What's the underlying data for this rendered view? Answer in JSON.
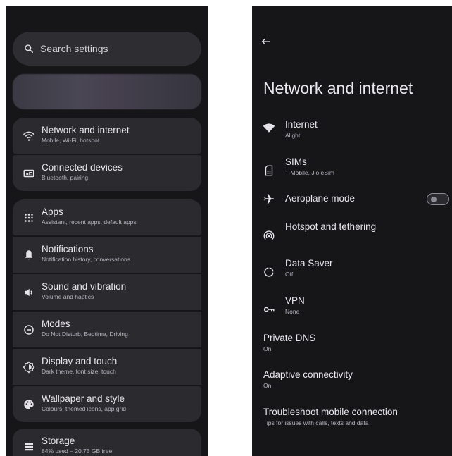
{
  "settings": {
    "search": {
      "placeholder": "Search settings"
    },
    "groups": [
      [
        {
          "title": "Network and internet",
          "subtitle": "Mobile, Wi-Fi, hotspot",
          "icon": "wifi-icon"
        },
        {
          "title": "Connected devices",
          "subtitle": "Bluetooth, pairing",
          "icon": "connected-devices-icon"
        }
      ],
      [
        {
          "title": "Apps",
          "subtitle": "Assistant, recent apps, default apps",
          "icon": "apps-grid-icon"
        },
        {
          "title": "Notifications",
          "subtitle": "Notification history, conversations",
          "icon": "bell-icon"
        },
        {
          "title": "Sound and vibration",
          "subtitle": "Volume and haptics",
          "icon": "speaker-icon"
        },
        {
          "title": "Modes",
          "subtitle": "Do Not Disturb, Bedtime, Driving",
          "icon": "modes-icon"
        },
        {
          "title": "Display and touch",
          "subtitle": "Dark theme, font size, touch",
          "icon": "display-icon"
        },
        {
          "title": "Wallpaper and style",
          "subtitle": "Colours, themed icons, app grid",
          "icon": "palette-icon"
        }
      ],
      [
        {
          "title": "Storage",
          "subtitle": "84% used – 20.75 GB free",
          "icon": "storage-icon"
        }
      ]
    ]
  },
  "network": {
    "title": "Network and internet",
    "items": [
      {
        "title": "Internet",
        "subtitle": "Alight",
        "icon": "wifi-filled-icon"
      },
      {
        "title": "SIMs",
        "subtitle": "T-Mobile, Jio eSim",
        "icon": "sim-card-icon"
      },
      {
        "title": "Aeroplane mode",
        "subtitle": "",
        "icon": "airplane-icon",
        "toggle": false
      },
      {
        "title": "Hotspot and tethering",
        "subtitle": "",
        "icon": "hotspot-icon"
      },
      {
        "title": "Data Saver",
        "subtitle": "Off",
        "icon": "data-saver-icon"
      },
      {
        "title": "VPN",
        "subtitle": "None",
        "icon": "vpn-key-icon"
      },
      {
        "title": "Private DNS",
        "subtitle": "On"
      },
      {
        "title": "Adaptive connectivity",
        "subtitle": "On"
      },
      {
        "title": "Troubleshoot mobile connection",
        "subtitle": "Tips for issues with calls, texts and data"
      }
    ]
  },
  "colors": {
    "background": "#161619",
    "card": "#2a2a2f",
    "search": "#2d2d32",
    "text": "#ebe7ef",
    "subtext": "#b8b4bf"
  }
}
